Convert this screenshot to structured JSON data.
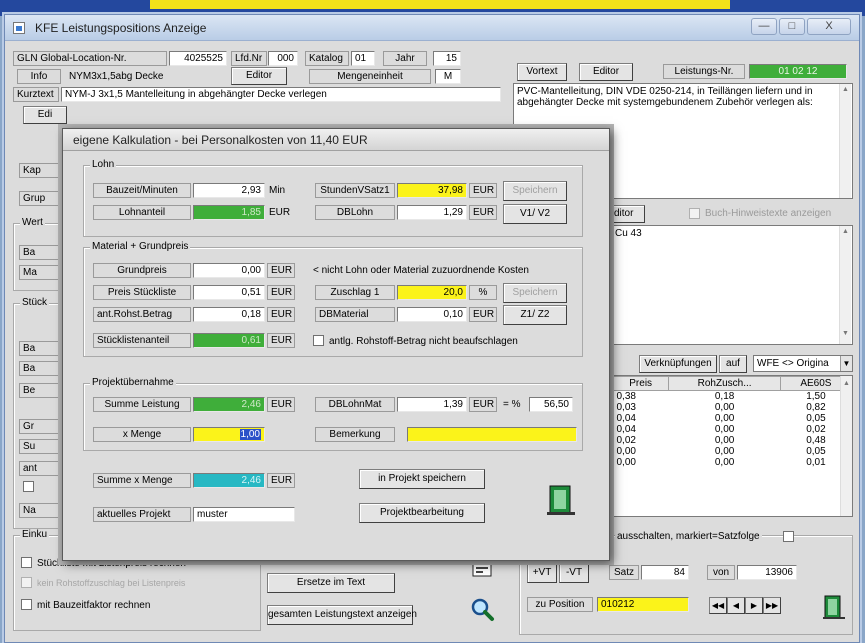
{
  "window": {
    "title": "KFE Leistungspositions Anzeige",
    "close_glyph": "X"
  },
  "header": {
    "gln_label": "GLN Global-Location-Nr.",
    "gln_value": "4025525",
    "lfd_label": "Lfd.Nr",
    "lfd_value": "000",
    "katalog_label": "Katalog",
    "katalog_value": "01",
    "jahr_label": "Jahr",
    "jahr_value": "15",
    "info_label": "Info",
    "info_value": "NYM3x1,5abg Decke",
    "editor_label": "Editor",
    "mengeneinheit_label": "Mengeneinheit",
    "mengeneinheit_value": "M",
    "kurztext_label": "Kurztext",
    "kurztext_value": "NYM-J 3x1,5 Mantelleitung in abgehängter Decke verlegen",
    "edit_btn_label": "Edi"
  },
  "right_panel": {
    "vortext_label": "Vortext",
    "editor_label": "Editor",
    "leistungs_nr_label": "Leistungs-Nr.",
    "leistungs_nr_value": "01 02 12",
    "langtext": "PVC-Mantelleitung, DIN VDE 0250-214, in Teillängen liefern und in abgehängter Decke mit systemgebundenem Zubehör verlegen als:",
    "editor2_label": "ditor",
    "buch_hinweis_label": "Buch-Hinweistexte anzeigen",
    "langtext2": "Cu 43",
    "verknuepfungen_label": "Verknüpfungen",
    "auf_label": "auf",
    "wfe_select": "WFE <> Origina"
  },
  "left_stubs": {
    "kap": "Kap",
    "grup": "Grup",
    "wert": "Wert",
    "ba": "Ba",
    "ma": "Ma",
    "stuck": "Stück",
    "ba2": "Ba",
    "ba3": "Ba",
    "be": "Be",
    "gr": "Gr",
    "su": "Su",
    "ant": "ant",
    "na": "Na",
    "einku": "Einku"
  },
  "table": {
    "headers": [
      "Preis",
      "RohZusch...",
      "AE60S"
    ],
    "rows": [
      [
        "0,38",
        "0,18",
        "1,50"
      ],
      [
        "0,03",
        "0,00",
        "0,82"
      ],
      [
        "0,04",
        "0,00",
        "0,05"
      ],
      [
        "0,04",
        "0,00",
        "0,02"
      ],
      [
        "0,02",
        "0,00",
        "0,48"
      ],
      [
        "0,00",
        "0,00",
        "0,05"
      ],
      [
        "0,00",
        "0,00",
        "0,01"
      ]
    ]
  },
  "bottom": {
    "chk_stueckliste": "Stückliste mit Listenpreis rechnen",
    "chk_rohstoff": "kein Rohstoffzuschlag bei Listenpreis",
    "chk_bauzeit": "mit Bauzeitfaktor rechnen",
    "ersetze_btn": "Ersetze im Text",
    "gesamten_btn": "gesamten Leistungstext anzeigen",
    "ausschalten_label": "ausschalten, markiert=Satzfolge",
    "vt_plus": "+VT",
    "vt_minus": "-VT",
    "satz_label": "Satz",
    "satz_value": "84",
    "von_label": "von",
    "von_value": "13906",
    "zu_position_label": "zu Position",
    "zu_position_value": "010212"
  },
  "dialog": {
    "title": "eigene Kalkulation - bei Personalkosten von 11,40 EUR",
    "lohn": {
      "legend": "Lohn",
      "bauzeit_label": "Bauzeit/Minuten",
      "bauzeit_value": "2,93",
      "bauzeit_unit": "Min",
      "stundenvsatz_label": "StundenVSatz1",
      "stundenvsatz_value": "37,98",
      "stundenvsatz_unit": "EUR",
      "speichern_label": "Speichern",
      "lohnanteil_label": "Lohnanteil",
      "lohnanteil_value": "1,85",
      "lohnanteil_unit": "EUR",
      "dblohn_label": "DBLohn",
      "dblohn_value": "1,29",
      "dblohn_unit": "EUR",
      "v1v2_label": "V1/ V2"
    },
    "material": {
      "legend": "Material + Grundpreis",
      "grundpreis_label": "Grundpreis",
      "grundpreis_value": "0,00",
      "grundpreis_unit": "EUR",
      "hint": "< nicht Lohn oder Material zuzuordnende Kosten",
      "preis_label": "Preis Stückliste",
      "preis_value": "0,51",
      "preis_unit": "EUR",
      "zuschlag_label": "Zuschlag 1",
      "zuschlag_value": "20,0",
      "zuschlag_unit": "%",
      "speichern_label": "Speichern",
      "rohst_label": "ant.Rohst.Betrag",
      "rohst_value": "0,18",
      "rohst_unit": "EUR",
      "dbmaterial_label": "DBMaterial",
      "dbmaterial_value": "0,10",
      "dbmaterial_unit": "EUR",
      "z1z2_label": "Z1/ Z2",
      "stuecklistenanteil_label": "Stücklistenanteil",
      "stuecklistenanteil_value": "0,61",
      "stuecklistenanteil_unit": "EUR",
      "antlg_label": "antlg. Rohstoff-Betrag nicht beaufschlagen"
    },
    "projekt": {
      "legend": "Projektübernahme",
      "summe_label": "Summe Leistung",
      "summe_value": "2,46",
      "summe_unit": "EUR",
      "dblohnmat_label": "DBLohnMat",
      "dblohnmat_value": "1,39",
      "dblohnmat_unit": "EUR",
      "eq_pct": "= %",
      "pct_value": "56,50",
      "menge_label": "x Menge",
      "menge_value": "1,00",
      "bemerkung_label": "Bemerkung",
      "bemerkung_value": ""
    },
    "summe_menge_label": "Summe x Menge",
    "summe_menge_value": "2,46",
    "summe_menge_unit": "EUR",
    "projekt_speichern_btn": "in Projekt speichern",
    "aktuelles_label": "aktuelles Projekt",
    "aktuelles_value": "muster",
    "projektbearbeitung_btn": "Projektbearbeitung"
  },
  "colors": {
    "green": "#3fae3a",
    "yellow": "#fbf31a",
    "cyan": "#27b8c3"
  }
}
